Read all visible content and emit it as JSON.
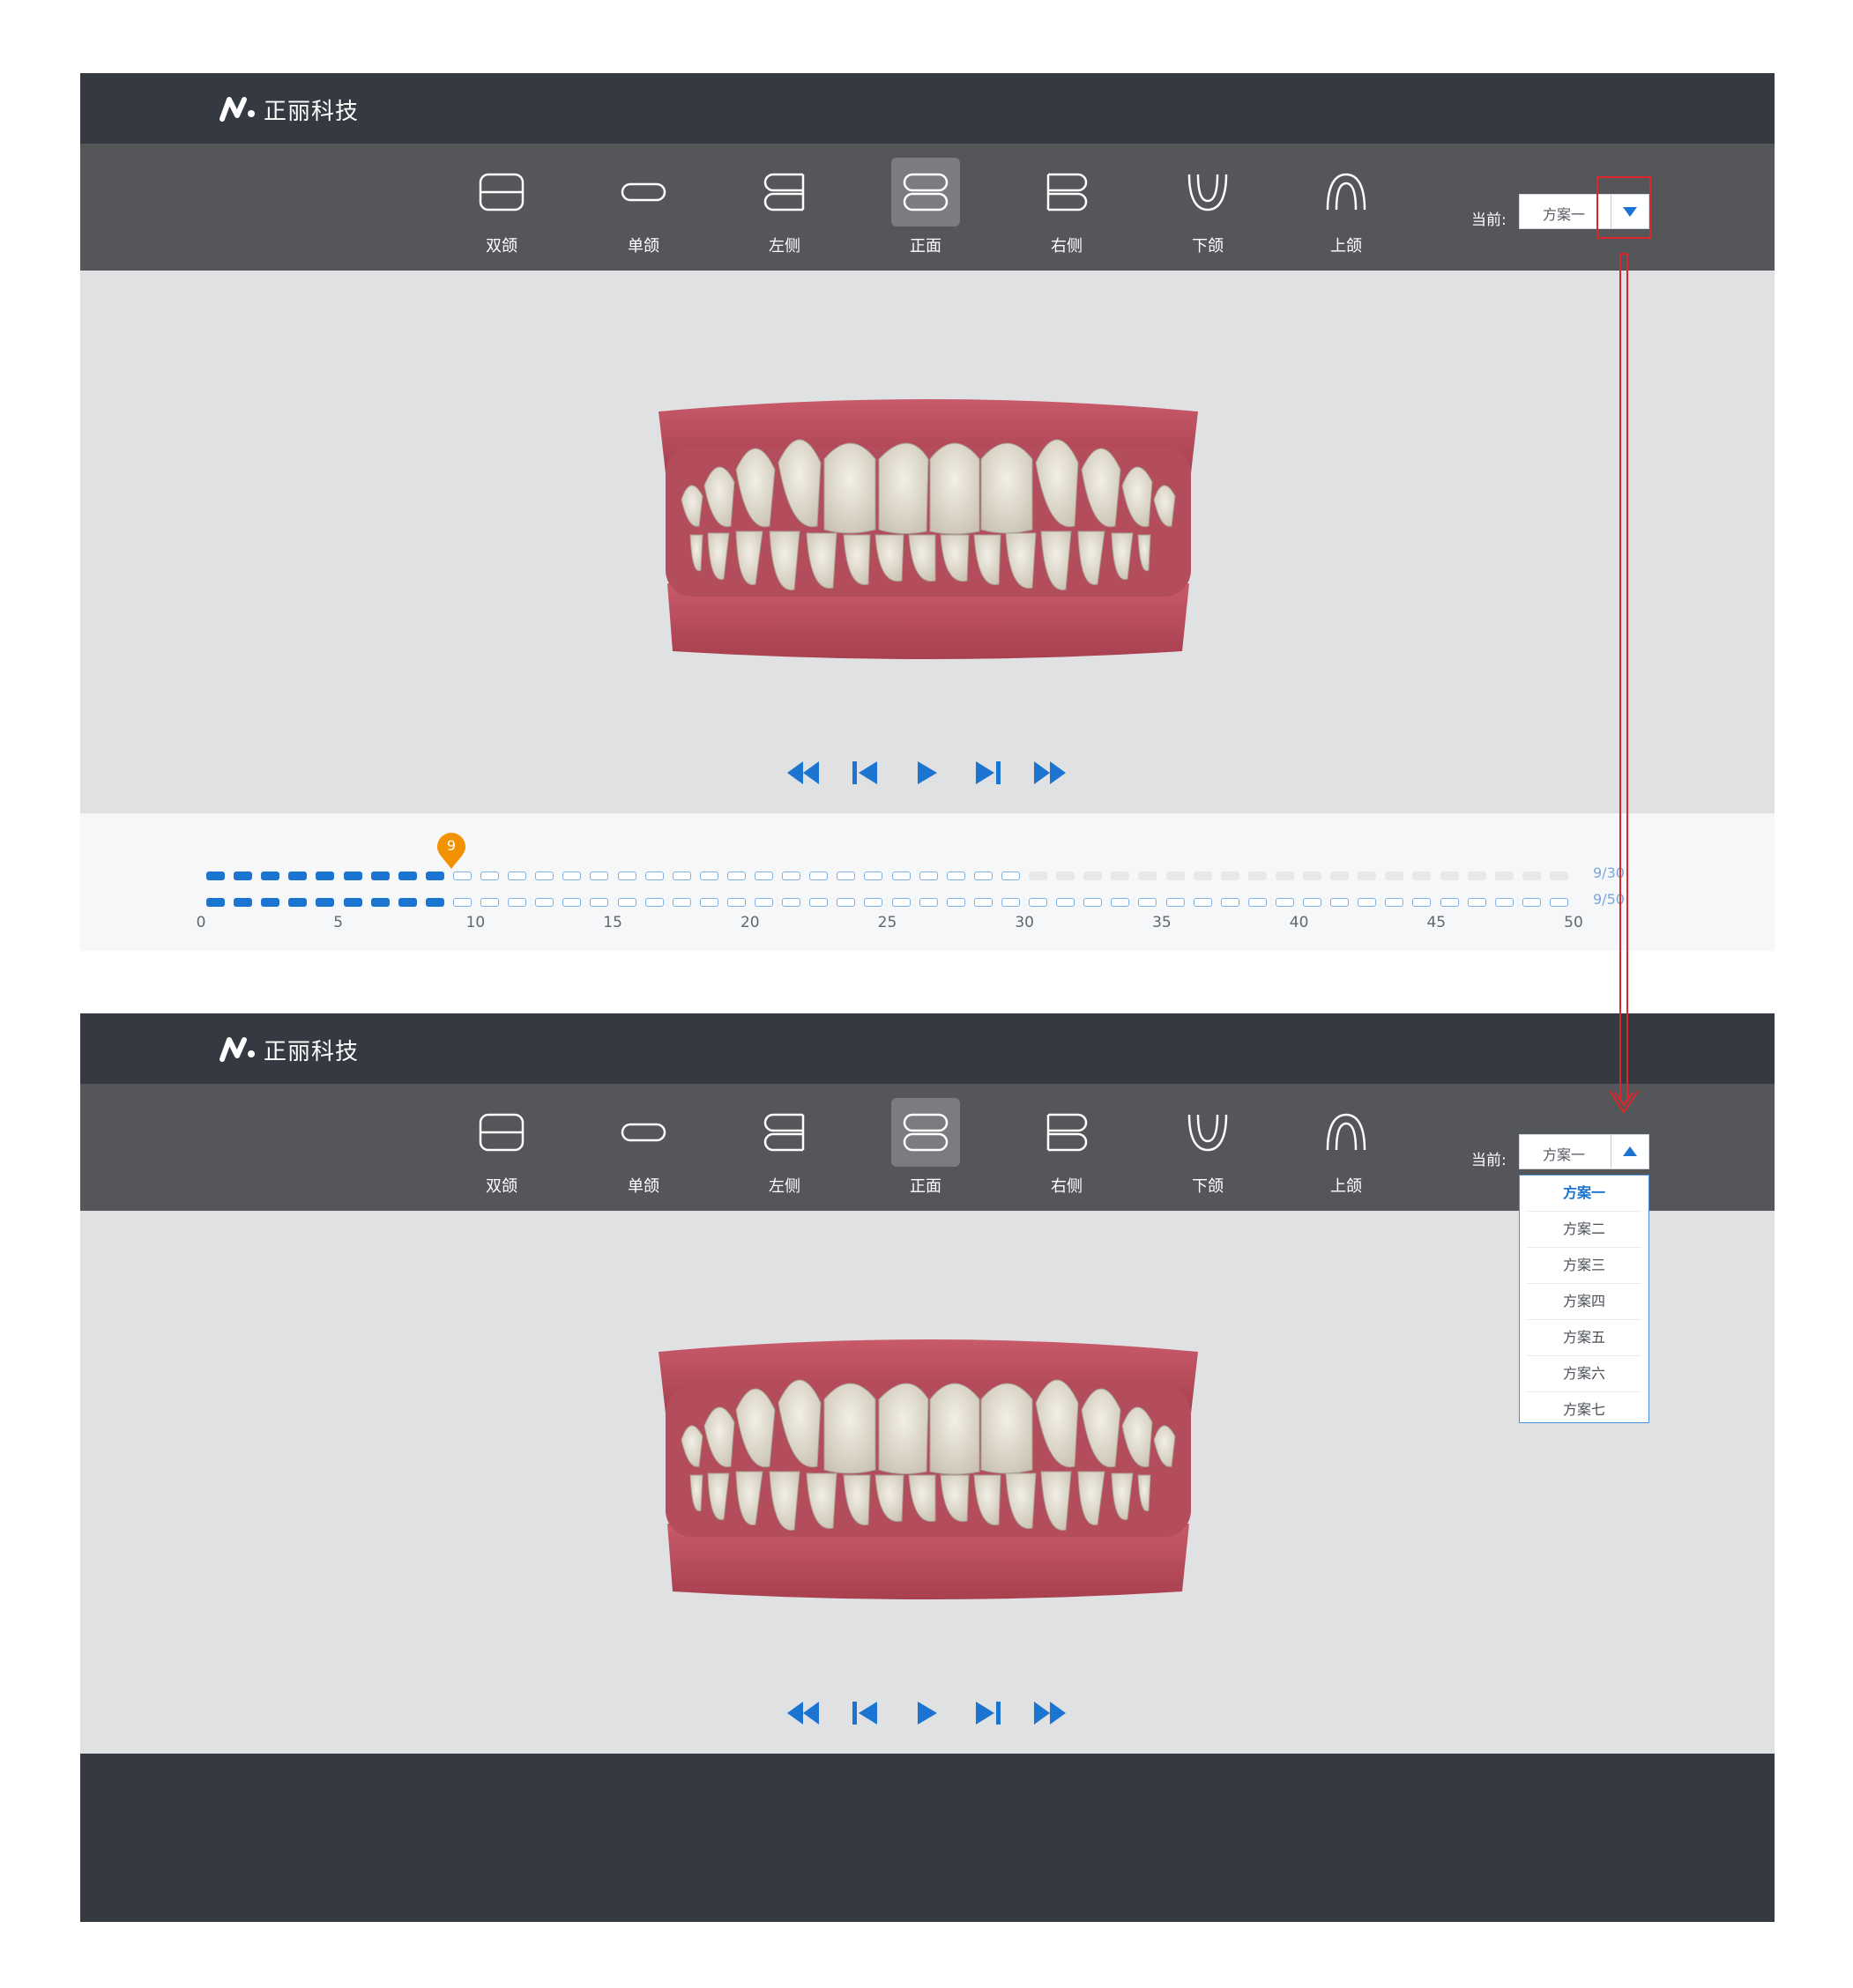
{
  "colors": {
    "topbar": "#343942",
    "toolbar": "#545659",
    "viewport": "#e0e1e3",
    "accent_blue": "#1b74d0",
    "marker_orange": "#f39200",
    "annotation_red": "#e0242b"
  },
  "brand": {
    "logo_text": "正丽科技",
    "logo_icon": "n-mark-logo"
  },
  "toolbar": {
    "tools": [
      {
        "label": "双颌",
        "icon": "double-jaw-icon",
        "active": false
      },
      {
        "label": "单颌",
        "icon": "single-jaw-icon",
        "active": false
      },
      {
        "label": "左侧",
        "icon": "left-side-icon",
        "active": false
      },
      {
        "label": "正面",
        "icon": "front-view-icon",
        "active": true
      },
      {
        "label": "右侧",
        "icon": "right-side-icon",
        "active": false
      },
      {
        "label": "下颌",
        "icon": "lower-jaw-icon",
        "active": false
      },
      {
        "label": "上颌",
        "icon": "upper-jaw-icon",
        "active": false
      }
    ],
    "current_label": "当前:",
    "plan_select": {
      "value": "方案一"
    }
  },
  "player": {
    "buttons": [
      "fast-backward-icon",
      "step-backward-icon",
      "play-icon",
      "step-forward-icon",
      "fast-forward-icon"
    ]
  },
  "timeline": {
    "current_step": "9",
    "upper_track": {
      "completed": 9,
      "total": 30,
      "capacity": 50,
      "label": "9/30"
    },
    "lower_track": {
      "completed": 9,
      "total": 50,
      "capacity": 50,
      "label": "9/50"
    },
    "ticks": [
      "0",
      "5",
      "10",
      "15",
      "20",
      "25",
      "30",
      "35",
      "40",
      "45",
      "50"
    ]
  },
  "dropdown": {
    "selected": "方案一",
    "options": [
      "方案一",
      "方案二",
      "方案三",
      "方案四",
      "方案五",
      "方案六",
      "方案七"
    ]
  }
}
